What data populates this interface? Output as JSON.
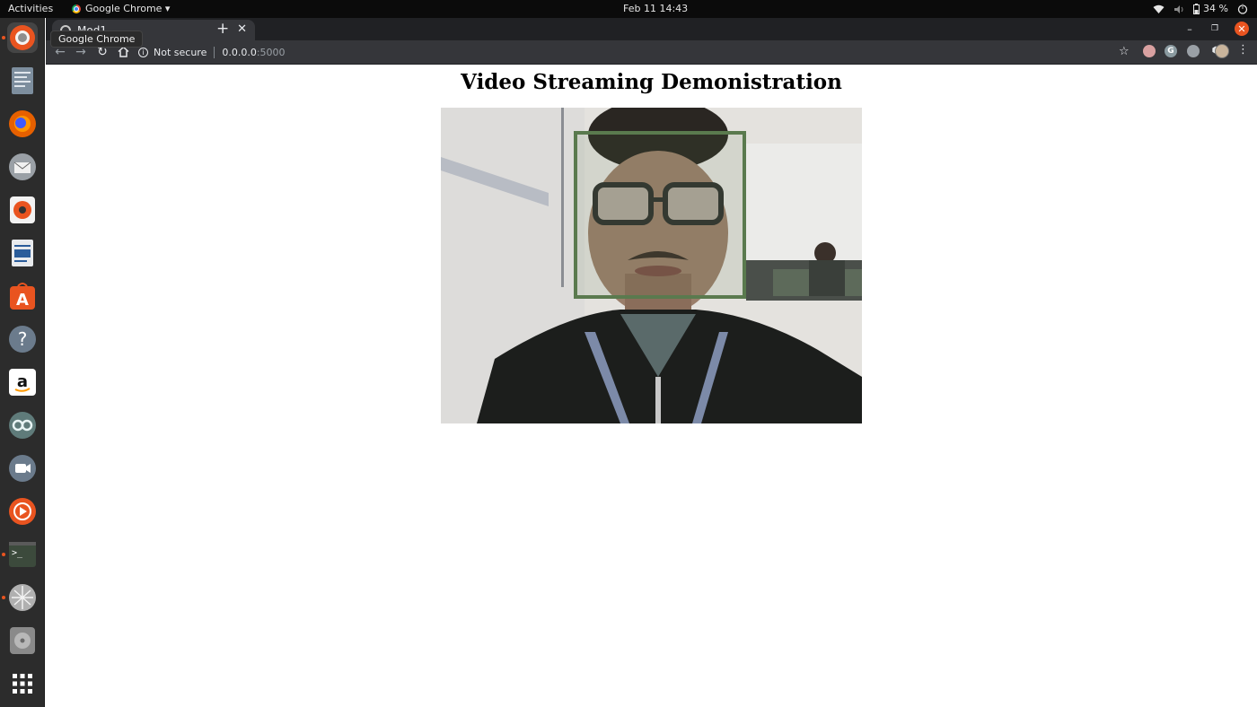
{
  "topbar": {
    "activities": "Activities",
    "app_menu": "Google Chrome ▾",
    "clock": "Feb 11  14:43",
    "battery": "34 %"
  },
  "dock": {
    "items": [
      {
        "name": "chromium-icon",
        "color": "#e95420"
      },
      {
        "name": "text-editor-icon",
        "color": "#7d8e9e"
      },
      {
        "name": "firefox-icon",
        "color": "#e66000"
      },
      {
        "name": "thunderbird-icon",
        "color": "#9aa0a6"
      },
      {
        "name": "rhythmbox-icon",
        "color": "#f2f2f2"
      },
      {
        "name": "libreoffice-writer-icon",
        "color": "#e8eaed"
      },
      {
        "name": "ubuntu-software-icon",
        "color": "#e95420"
      },
      {
        "name": "help-icon",
        "color": "#6b7b8c"
      },
      {
        "name": "amazon-icon",
        "color": "#ffffff"
      },
      {
        "name": "arduino-icon",
        "color": "#00878f"
      },
      {
        "name": "zoom-icon",
        "color": "#6b7b8c"
      },
      {
        "name": "media-player-icon",
        "color": "#e95420"
      },
      {
        "name": "terminal-icon",
        "color": "#3c4a3c"
      },
      {
        "name": "network-icon",
        "color": "#b0b0b0"
      },
      {
        "name": "disk-icon",
        "color": "#8a8a8a"
      },
      {
        "name": "app-grid-icon",
        "color": "#ffffff"
      }
    ]
  },
  "browser": {
    "tab_title": "Mod1",
    "tooltip": "Google Chrome",
    "security_label": "Not secure",
    "url_host": "0.0.0.0",
    "url_port": ":5000"
  },
  "page": {
    "title": "Video Streaming Demonistration"
  },
  "colors": {
    "face_box": "#5a7a4e",
    "accent": "#e95420"
  }
}
